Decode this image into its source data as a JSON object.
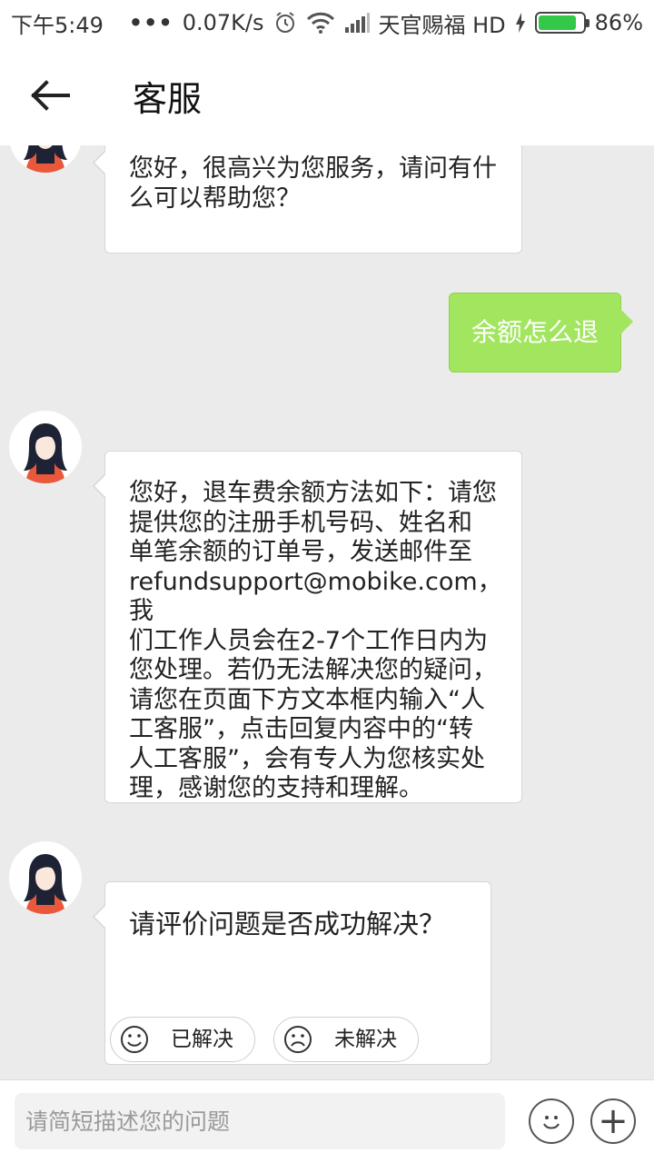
{
  "status_bar": {
    "time": "下午5:49",
    "speed": "0.07K/s",
    "carrier": "天官赐福 HD",
    "battery": "86%",
    "battery_level": 0.86
  },
  "header": {
    "title": "客服",
    "back_icon": "arrow-left-icon"
  },
  "messages": [
    {
      "from": "agent",
      "text": "您好，很高兴为您服务，请问有什\n么可以帮助您？"
    },
    {
      "from": "user",
      "text": "余额怎么退"
    },
    {
      "from": "agent",
      "text": "您好，退车费余额方法如下：请您\n提供您的注册手机号码、姓名和\n单笔余额的订单号，发送邮件至\nrefundsupport@mobike.com，我\n们工作人员会在2-7个工作日内为\n您处理。若仍无法解决您的疑问，\n请您在页面下方文本框内输入“人\n工客服”，点击回复内容中的“转\n人工客服”，会有专人为您核实处\n理，感谢您的支持和理解。"
    },
    {
      "from": "agent",
      "text": "请评价问题是否成功解决？",
      "buttons": [
        "已解决",
        "未解决"
      ]
    }
  ],
  "input": {
    "placeholder": "请简短描述您的问题",
    "emoji_icon": "smiley-icon",
    "plus_icon": "plus-icon"
  },
  "colors": {
    "user_bubble": "#a2e55f",
    "background": "#ebebeb",
    "avatar_accent": "#e9583a"
  }
}
